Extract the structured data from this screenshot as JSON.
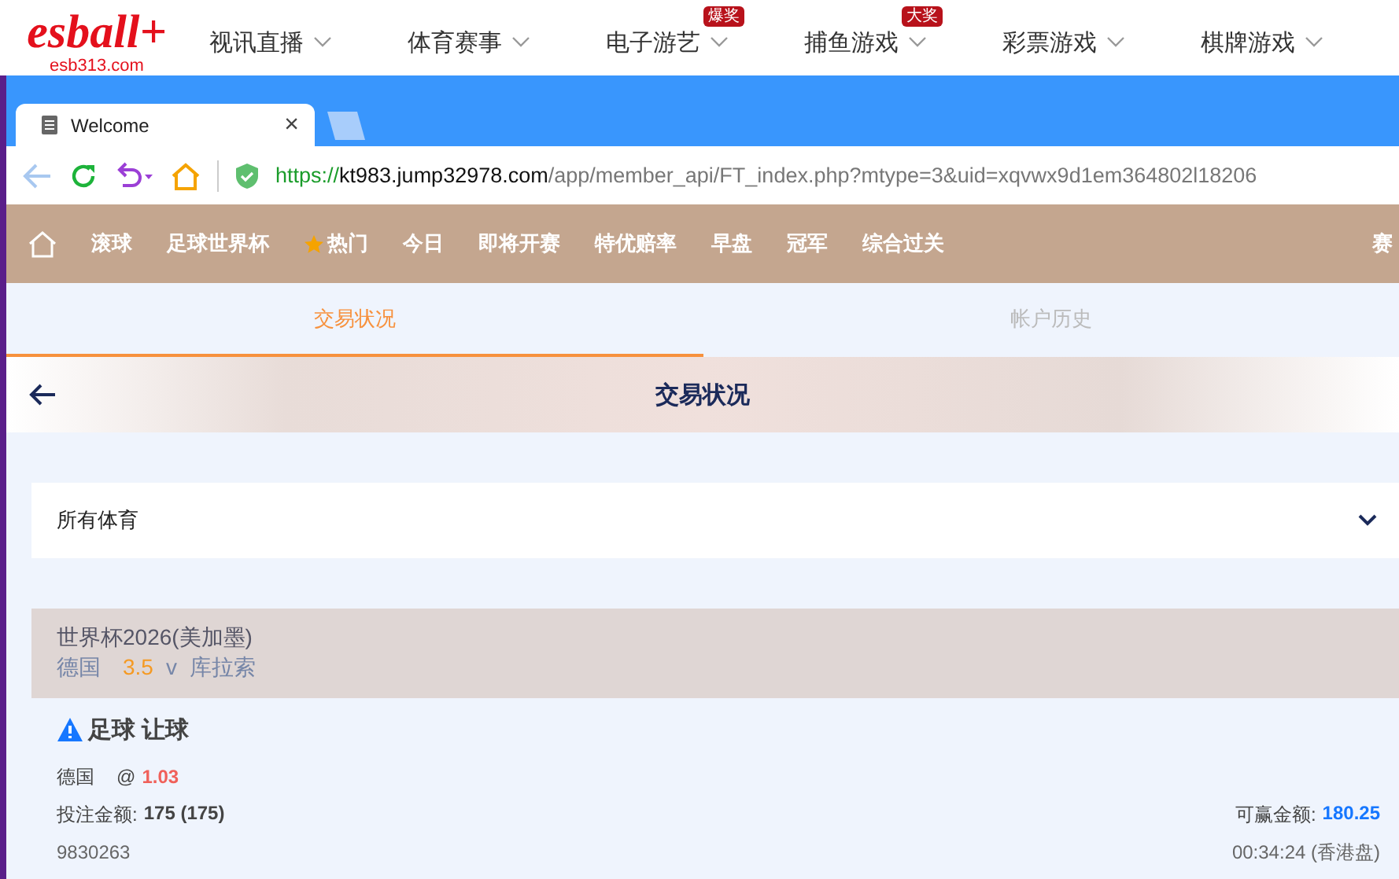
{
  "site_header": {
    "logo": "esball+",
    "logo_sub": "esb313.com",
    "nav": [
      {
        "label": "视讯直播"
      },
      {
        "label": "体育赛事"
      },
      {
        "label": "电子游艺",
        "badge": "爆奖"
      },
      {
        "label": "捕鱼游戏",
        "badge": "大奖"
      },
      {
        "label": "彩票游戏"
      },
      {
        "label": "棋牌游戏"
      }
    ]
  },
  "browser": {
    "tab": {
      "title": "Welcome",
      "close": "×"
    },
    "url": {
      "scheme": "https://",
      "host": "kt983.jump32978.com",
      "path": "/app/member_api/FT_index.php?mtype=3&uid=xqvwx9d1em364802l18206"
    }
  },
  "sports_nav": [
    {
      "label": "滚球",
      "kind": "plain"
    },
    {
      "label": "足球世界杯",
      "kind": "plain"
    },
    {
      "label": "热门",
      "kind": "hot"
    },
    {
      "label": "今日",
      "kind": "plain"
    },
    {
      "label": "即将开赛",
      "kind": "plain"
    },
    {
      "label": "特优赔率",
      "kind": "plain"
    },
    {
      "label": "早盘",
      "kind": "plain"
    },
    {
      "label": "冠军",
      "kind": "plain"
    },
    {
      "label": "综合过关",
      "kind": "plain"
    },
    {
      "label": "赛",
      "kind": "plain"
    }
  ],
  "tabs": [
    {
      "label": "交易状况",
      "selected": true
    },
    {
      "label": "帐户历史",
      "selected": false
    }
  ],
  "page_title": "交易状况",
  "filter": {
    "value": "所有体育"
  },
  "bet": {
    "league": "世界杯2026(美加墨)",
    "home": "德国",
    "line": "3.5",
    "vs": "v",
    "away": "库拉索",
    "title": "足球 让球",
    "pick": "德国",
    "at": "@",
    "odds": "1.03",
    "stake_label": "投注金额:",
    "stake": "175 (175)",
    "win_label": "可赢金额:",
    "win": "180.25",
    "ticket": "9830263",
    "time": "00:34:24 (香港盘)"
  }
}
